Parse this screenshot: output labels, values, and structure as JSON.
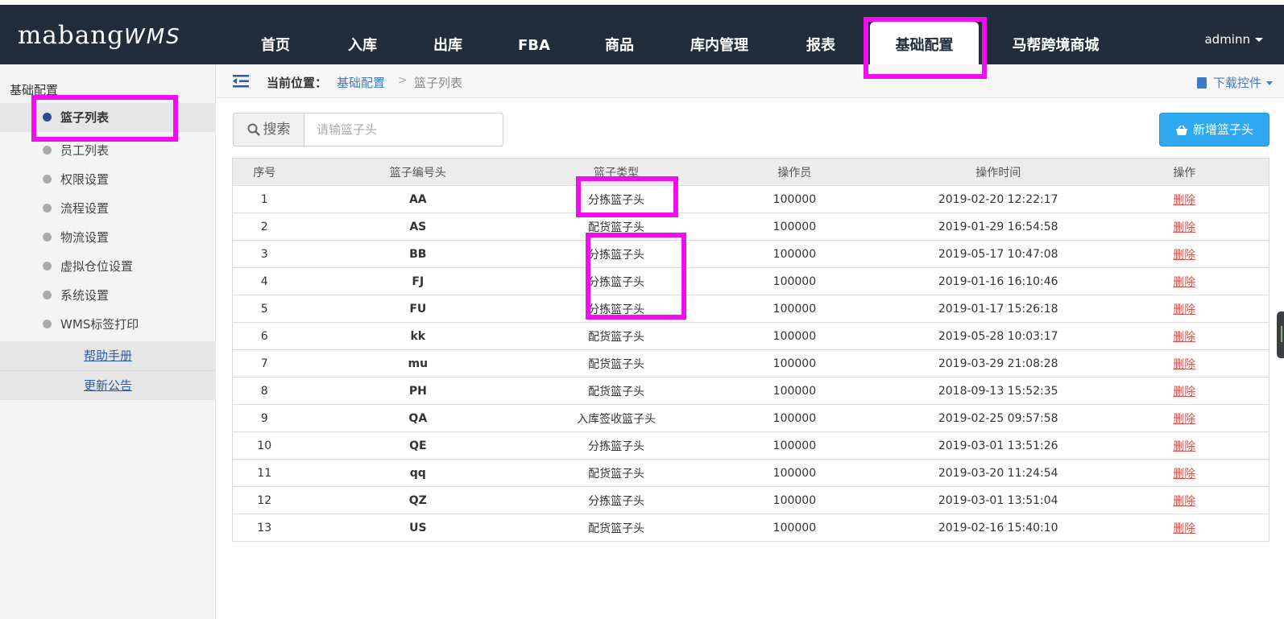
{
  "header": {
    "logo_main": "mabang",
    "logo_suffix": "WMS",
    "nav": [
      {
        "label": "首页"
      },
      {
        "label": "入库"
      },
      {
        "label": "出库"
      },
      {
        "label": "FBA"
      },
      {
        "label": "商品"
      },
      {
        "label": "库内管理"
      },
      {
        "label": "报表"
      },
      {
        "label": "基础配置",
        "active": true
      },
      {
        "label": "马帮跨境商城"
      }
    ],
    "user": "adminn"
  },
  "sidebar": {
    "title": "基础配置",
    "items": [
      {
        "label": "篮子列表",
        "active": true
      },
      {
        "label": "员工列表"
      },
      {
        "label": "权限设置"
      },
      {
        "label": "流程设置"
      },
      {
        "label": "物流设置"
      },
      {
        "label": "虚拟仓位设置"
      },
      {
        "label": "系统设置"
      },
      {
        "label": "WMS标签打印"
      }
    ],
    "links": [
      {
        "label": "帮助手册"
      },
      {
        "label": "更新公告"
      }
    ]
  },
  "breadcrumb": {
    "prefix": "当前位置：",
    "parent": "基础配置",
    "separator": ">",
    "current": "篮子列表",
    "download": "下载控件"
  },
  "toolbar": {
    "search_label": "搜索",
    "search_placeholder": "请输篮子头",
    "add_label": "新增篮子头"
  },
  "table": {
    "headers": [
      "序号",
      "篮子编号头",
      "篮子类型",
      "操作员",
      "操作时间",
      "操作"
    ],
    "rows": [
      {
        "no": "1",
        "code": "AA",
        "type": "分拣篮子头",
        "operator": "100000",
        "time": "2019-02-20 12:22:17",
        "action": "删除"
      },
      {
        "no": "2",
        "code": "AS",
        "type": "配货篮子头",
        "operator": "100000",
        "time": "2019-01-29 16:54:58",
        "action": "删除"
      },
      {
        "no": "3",
        "code": "BB",
        "type": "分拣篮子头",
        "operator": "100000",
        "time": "2019-05-17 10:47:08",
        "action": "删除"
      },
      {
        "no": "4",
        "code": "FJ",
        "type": "分拣篮子头",
        "operator": "100000",
        "time": "2019-01-16 16:10:46",
        "action": "删除"
      },
      {
        "no": "5",
        "code": "FU",
        "type": "分拣篮子头",
        "operator": "100000",
        "time": "2019-01-17 15:26:18",
        "action": "删除"
      },
      {
        "no": "6",
        "code": "kk",
        "type": "配货篮子头",
        "operator": "100000",
        "time": "2019-05-28 10:03:17",
        "action": "删除"
      },
      {
        "no": "7",
        "code": "mu",
        "type": "配货篮子头",
        "operator": "100000",
        "time": "2019-03-29 21:08:28",
        "action": "删除"
      },
      {
        "no": "8",
        "code": "PH",
        "type": "配货篮子头",
        "operator": "100000",
        "time": "2018-09-13 15:52:35",
        "action": "删除"
      },
      {
        "no": "9",
        "code": "QA",
        "type": "入库签收篮子头",
        "operator": "100000",
        "time": "2019-02-25 09:57:58",
        "action": "删除"
      },
      {
        "no": "10",
        "code": "QE",
        "type": "分拣篮子头",
        "operator": "100000",
        "time": "2019-03-01 13:51:26",
        "action": "删除"
      },
      {
        "no": "11",
        "code": "qq",
        "type": "配货篮子头",
        "operator": "100000",
        "time": "2019-03-20 11:24:54",
        "action": "删除"
      },
      {
        "no": "12",
        "code": "QZ",
        "type": "分拣篮子头",
        "operator": "100000",
        "time": "2019-03-01 13:51:04",
        "action": "删除"
      },
      {
        "no": "13",
        "code": "US",
        "type": "配货篮子头",
        "operator": "100000",
        "time": "2019-02-16 15:40:10",
        "action": "删除"
      }
    ]
  },
  "colors": {
    "header_bg": "#222d3b",
    "accent_blue": "#2ea8ef",
    "link_blue": "#3b7cc7",
    "delete_red": "#d9534f",
    "annotation_magenta": "#f00ef0"
  }
}
